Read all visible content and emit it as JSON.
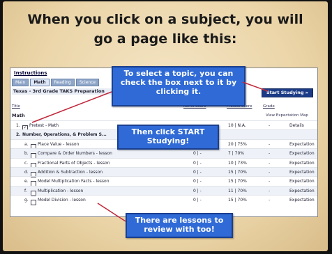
{
  "slide": {
    "title_line1": "When you click on a subject, you will",
    "title_line2": "go a page like this:"
  },
  "screenshot": {
    "instructions_label": "Instructions",
    "tabs": [
      "Main",
      "Math",
      "Reading",
      "Science"
    ],
    "subheading": "Texas - 3rd Grade TAKS Preparation",
    "start_button": "Start Studying »",
    "columns": {
      "title": "Title",
      "items": "Items Score",
      "pretest": "Pretest Score",
      "grade": "Grade"
    },
    "section": "Math",
    "view_expectation_map": "View Expectation Map",
    "rows": [
      {
        "label": "Pretest - Math",
        "items": "10",
        "score": "N.A.",
        "grade": "-",
        "action": "Details",
        "checked": true,
        "num": "1."
      },
      {
        "label": "Number, Operations, & Problem S...",
        "items": "",
        "score": "",
        "grade": "",
        "action": "",
        "checked": false,
        "num": "2."
      },
      {
        "label": "Place Value - lesson",
        "items": "20",
        "score": "75%",
        "grade": "-",
        "action": "Expectation",
        "checked": false,
        "num": "a."
      },
      {
        "label": "Compare & Order Numbers - lesson",
        "items": "7",
        "score": "70%",
        "grade": "-",
        "action": "Expectation",
        "checked": false,
        "num": "b."
      },
      {
        "label": "Fractional Parts of Objects - lesson",
        "items": "10",
        "score": "73%",
        "grade": "-",
        "action": "Expectation",
        "checked": false,
        "num": "c."
      },
      {
        "label": "Addition & Subtraction - lesson",
        "items": "15",
        "score": "70%",
        "grade": "-",
        "action": "Expectation",
        "checked": false,
        "num": "d."
      },
      {
        "label": "Model Multiplication Facts - lesson",
        "items": "15",
        "score": "70%",
        "grade": "-",
        "action": "Expectation",
        "checked": false,
        "num": "e."
      },
      {
        "label": "Multiplication - lesson",
        "items": "11",
        "score": "70%",
        "grade": "-",
        "action": "Expectation",
        "checked": false,
        "num": "f."
      },
      {
        "label": "Model Division - lesson",
        "items": "15",
        "score": "70%",
        "grade": "-",
        "action": "Expectation",
        "checked": false,
        "num": "g."
      }
    ]
  },
  "callouts": {
    "select_topic": "To select a topic, you can check the box next to it by clicking it.",
    "start": "Then click START Studying!",
    "lessons": "There are lessons to review with too!"
  },
  "colors": {
    "callout_blue": "#2f6ad6",
    "button_navy": "#1b3b86",
    "arrow_red": "#c0283a"
  }
}
